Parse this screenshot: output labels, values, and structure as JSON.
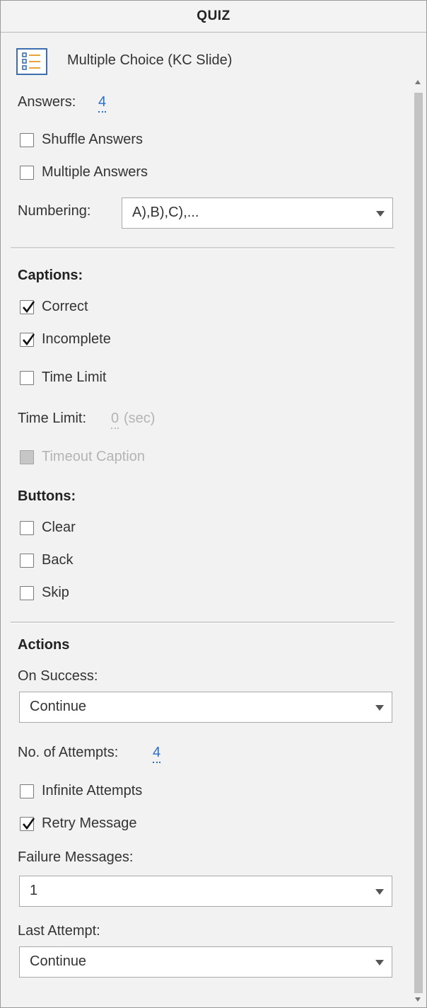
{
  "panel": {
    "title": "QUIZ"
  },
  "slide": {
    "icon": "list-icon",
    "type_label": "Multiple Choice (KC Slide)"
  },
  "answers": {
    "label": "Answers:",
    "value": "4",
    "shuffle": {
      "label": "Shuffle Answers",
      "checked": false
    },
    "multiple": {
      "label": "Multiple Answers",
      "checked": false
    },
    "numbering_label": "Numbering:",
    "numbering_value": "A),B),C),..."
  },
  "captions": {
    "heading": "Captions:",
    "correct": {
      "label": "Correct",
      "checked": true
    },
    "incomplete": {
      "label": "Incomplete",
      "checked": true
    },
    "time_limit_cb": {
      "label": "Time Limit",
      "checked": false
    },
    "time_limit_label": "Time Limit:",
    "time_limit_value": "0",
    "time_limit_unit": "(sec)",
    "timeout": {
      "label": "Timeout Caption",
      "checked": false,
      "disabled": true
    }
  },
  "buttons": {
    "heading": "Buttons:",
    "clear": {
      "label": "Clear",
      "checked": false
    },
    "back": {
      "label": "Back",
      "checked": false
    },
    "skip": {
      "label": "Skip",
      "checked": false
    }
  },
  "actions": {
    "heading": "Actions",
    "on_success_label": "On Success:",
    "on_success_value": "Continue",
    "attempts_label": "No. of Attempts:",
    "attempts_value": "4",
    "infinite": {
      "label": "Infinite Attempts",
      "checked": false
    },
    "retry": {
      "label": "Retry Message",
      "checked": true
    },
    "failure_label": "Failure Messages:",
    "failure_value": "1",
    "last_attempt_label": "Last Attempt:",
    "last_attempt_value": "Continue"
  },
  "colors": {
    "accent": "#2a6fc9",
    "icon_blue": "#3b6fb0",
    "icon_orange": "#e8a33b"
  }
}
